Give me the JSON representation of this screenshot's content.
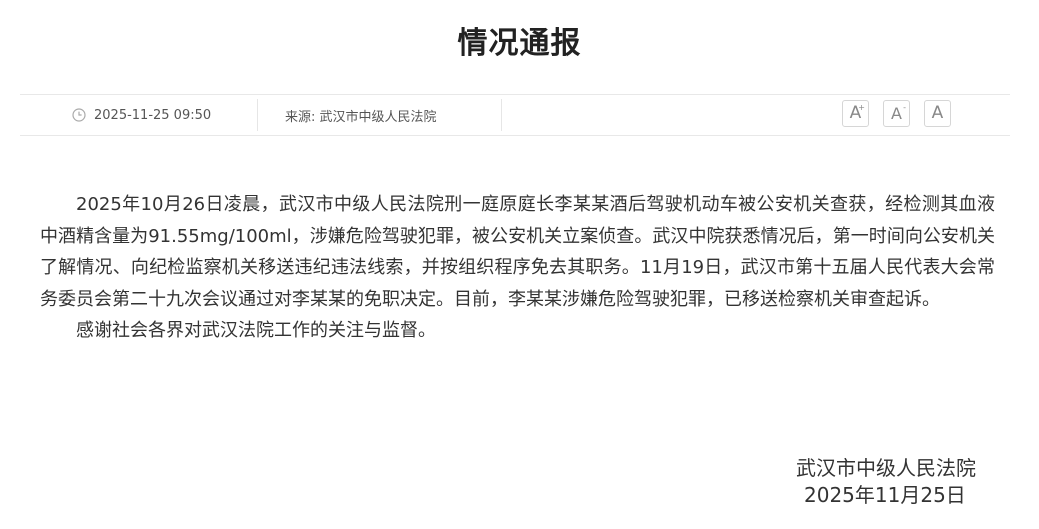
{
  "article": {
    "title": "情况通报",
    "date": "2025-11-25 09:50",
    "source": "来源: 武汉市中级人民法院",
    "font_controls": {
      "large_label": "A",
      "large_sup": "+",
      "medium_label": "A",
      "medium_sup": "-",
      "small_label": "A"
    },
    "paragraphs": [
      "2025年10月26日凌晨，武汉市中级人民法院刑一庭原庭长李某某酒后驾驶机动车被公安机关查获，经检测其血液中酒精含量为91.55mg/100ml，涉嫌危险驾驶犯罪，被公安机关立案侦查。武汉中院获悉情况后，第一时间向公安机关了解情况、向纪检监察机关移送违纪违法线索，并按组织程序免去其职务。11月19日，武汉市第十五届人民代表大会常务委员会第二十九次会议通过对李某某的免职决定。目前，李某某涉嫌危险驾驶犯罪，已移送检察机关审查起诉。",
      "感谢社会各界对武汉法院工作的关注与监督。"
    ],
    "signature": {
      "org": "武汉市中级人民法院",
      "date": "2025年11月25日"
    }
  }
}
